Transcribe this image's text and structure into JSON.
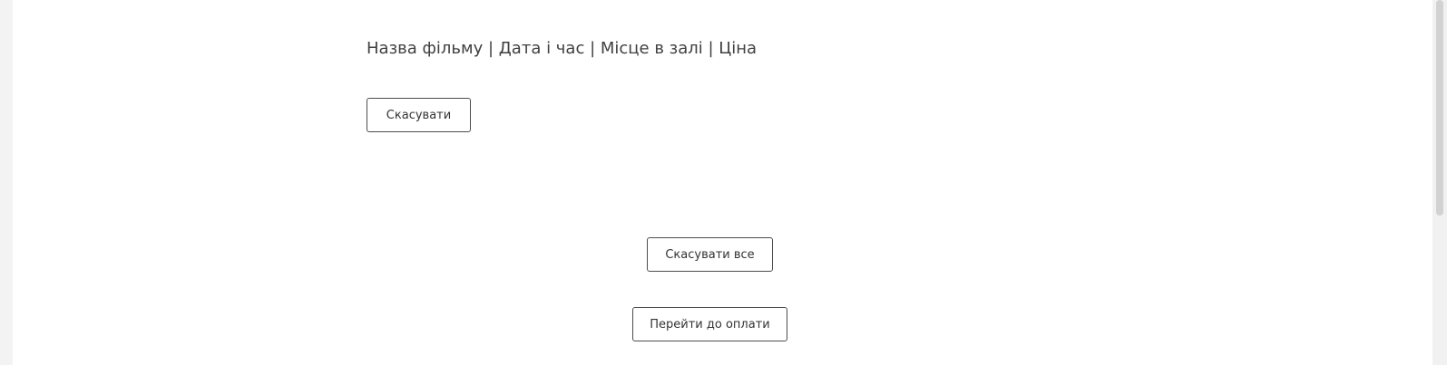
{
  "ticket": {
    "info_line": "Назва фільму | Дата і час | Місце в залі | Ціна",
    "cancel_label": "Скасувати"
  },
  "actions": {
    "cancel_all_label": "Скасувати все",
    "checkout_label": "Перейти до оплати"
  }
}
